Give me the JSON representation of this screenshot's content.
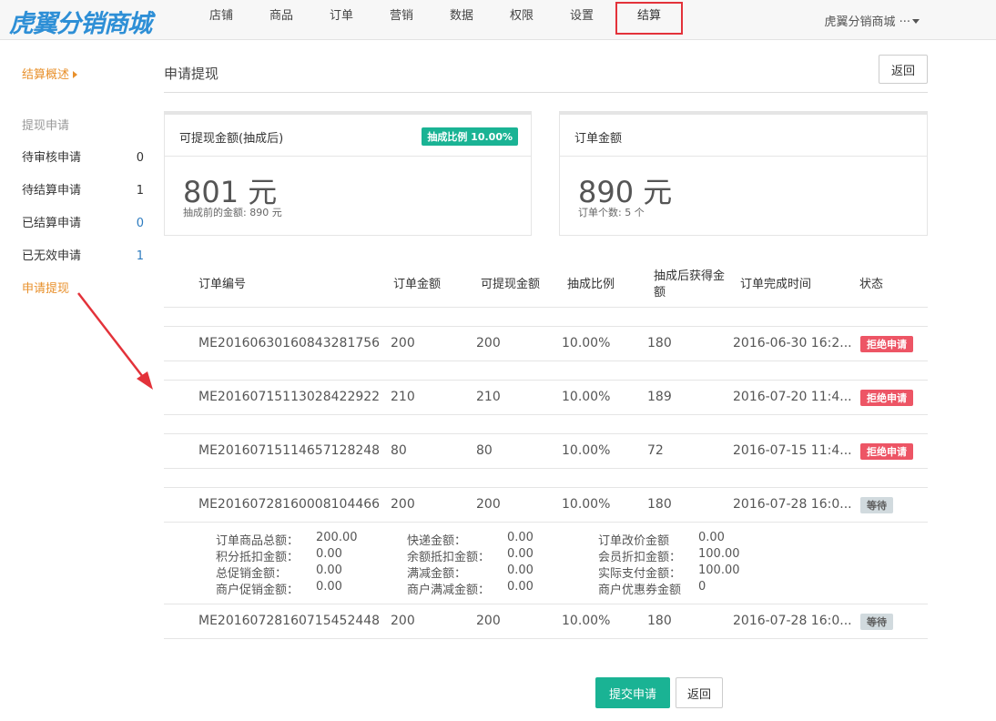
{
  "brand": {
    "logo": "虎翼分销商城"
  },
  "nav": {
    "items": [
      "店铺",
      "商品",
      "订单",
      "营销",
      "数据",
      "权限",
      "设置",
      "结算"
    ],
    "active": "结算",
    "user": "虎翼分销商城 ···"
  },
  "sidebar": {
    "overview": "结算概述",
    "group": "提现申请",
    "items": [
      {
        "label": "待审核申请",
        "count": "0"
      },
      {
        "label": "待结算申请",
        "count": "1"
      },
      {
        "label": "已结算申请",
        "count": "0"
      },
      {
        "label": "已无效申请",
        "count": "1"
      }
    ],
    "active_item": "申请提现"
  },
  "page": {
    "title": "申请提现",
    "back_label": "返回"
  },
  "cards": {
    "withdrawable": {
      "title": "可提现金额(抽成后)",
      "badge": "抽成比例 10.00%",
      "value": "801 元",
      "sub": "抽成前的金额: 890 元"
    },
    "order_amount": {
      "title": "订单金额",
      "value": "890 元",
      "sub": "订单个数: 5 个"
    }
  },
  "table": {
    "headers": [
      "订单编号",
      "订单金额",
      "可提现金额",
      "抽成比例",
      "抽成后获得金额",
      "订单完成时间",
      "状态"
    ],
    "header_split": {
      "line1": "抽成后获得金",
      "line2": "额"
    },
    "rows": [
      {
        "id": "ME20160630160843281756",
        "amount": "200",
        "withdrawable": "200",
        "rate": "10.00%",
        "net": "180",
        "time": "2016-06-30 16:2...",
        "status": "拒绝申请"
      },
      {
        "id": "ME20160715113028422922",
        "amount": "210",
        "withdrawable": "210",
        "rate": "10.00%",
        "net": "189",
        "time": "2016-07-20 11:4...",
        "status": "拒绝申请"
      },
      {
        "id": "ME20160715114657128248",
        "amount": "80",
        "withdrawable": "80",
        "rate": "10.00%",
        "net": "72",
        "time": "2016-07-15 11:4...",
        "status": "拒绝申请"
      },
      {
        "id": "ME20160728160008104466",
        "amount": "200",
        "withdrawable": "200",
        "rate": "10.00%",
        "net": "180",
        "time": "2016-07-28 16:0...",
        "status": "等待"
      },
      {
        "id": "ME20160728160715452448",
        "amount": "200",
        "withdrawable": "200",
        "rate": "10.00%",
        "net": "180",
        "time": "2016-07-28 16:0...",
        "status": "等待"
      }
    ],
    "detail": [
      [
        {
          "label": "订单商品总额：",
          "value": "200.00"
        },
        {
          "label": "快递金额：",
          "value": "0.00"
        },
        {
          "label": "订单改价金额",
          "value": "0.00"
        }
      ],
      [
        {
          "label": "积分抵扣金额：",
          "value": "0.00"
        },
        {
          "label": "余额抵扣金额：",
          "value": "0.00"
        },
        {
          "label": "会员折扣金额：",
          "value": "100.00"
        }
      ],
      [
        {
          "label": "总促销金额：",
          "value": "0.00"
        },
        {
          "label": "满减金额：",
          "value": "0.00"
        },
        {
          "label": "实际支付金额：",
          "value": "100.00"
        }
      ],
      [
        {
          "label": "商户促销金额：",
          "value": "0.00"
        },
        {
          "label": "商户满减金额：",
          "value": "0.00"
        },
        {
          "label": "商户优惠券金额",
          "value": "0"
        }
      ]
    ]
  },
  "actions": {
    "submit": "提交申请",
    "back": "返回"
  },
  "colors": {
    "accent": "#1ab394",
    "orange": "#e8902b",
    "reject": "#ed5565",
    "highlight": "#e3323a"
  }
}
